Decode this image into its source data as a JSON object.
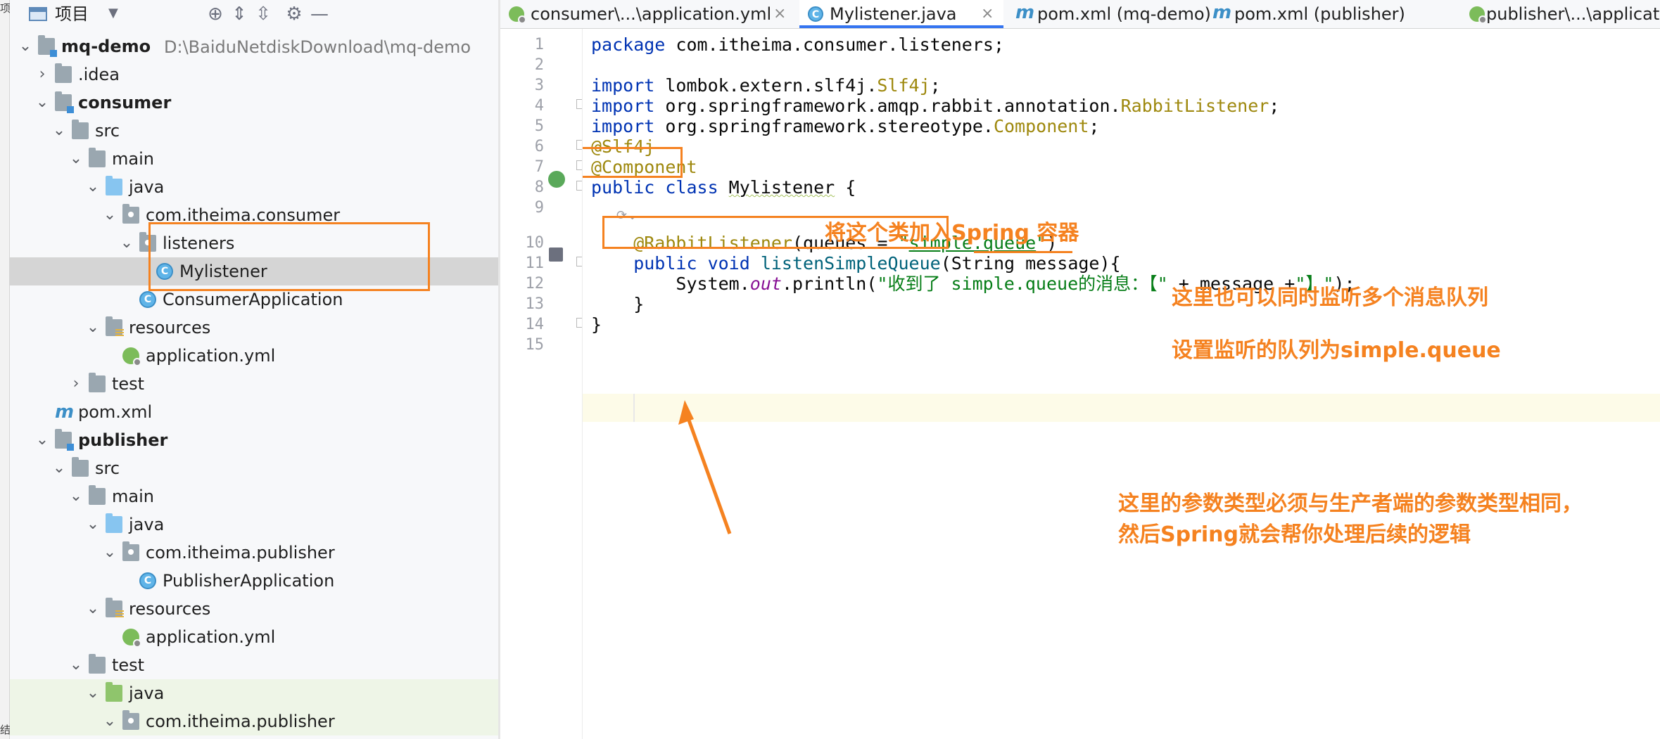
{
  "left_strip": {
    "chars_top": "项",
    "chars_bottom": "结"
  },
  "project_panel": {
    "title": "项目",
    "icons": [
      "locate-icon",
      "expand-all-icon",
      "collapse-all-icon",
      "settings-icon",
      "hide-icon"
    ]
  },
  "tree": [
    {
      "label": "mq-demo",
      "path": "D:\\BaiduNetdiskDownload\\mq-demo",
      "bold": true
    },
    {
      "label": ".idea"
    },
    {
      "label": "consumer",
      "bold": true
    },
    {
      "label": "src"
    },
    {
      "label": "main"
    },
    {
      "label": "java"
    },
    {
      "label": "com.itheima.consumer"
    },
    {
      "label": "listeners"
    },
    {
      "label": "Mylistener"
    },
    {
      "label": "ConsumerApplication"
    },
    {
      "label": "resources"
    },
    {
      "label": "application.yml"
    },
    {
      "label": "test"
    },
    {
      "label": "pom.xml"
    },
    {
      "label": "publisher",
      "bold": true
    },
    {
      "label": "src"
    },
    {
      "label": "main"
    },
    {
      "label": "java"
    },
    {
      "label": "com.itheima.publisher"
    },
    {
      "label": "PublisherApplication"
    },
    {
      "label": "resources"
    },
    {
      "label": "application.yml"
    },
    {
      "label": "test"
    },
    {
      "label": "java"
    },
    {
      "label": "com.itheima.publisher"
    }
  ],
  "tabs": [
    {
      "label": "consumer\\...\\application.yml",
      "icon": "spring-yml-icon",
      "closable": true
    },
    {
      "label": "Mylistener.java",
      "icon": "class-icon",
      "closable": true,
      "active": true
    },
    {
      "label": "pom.xml (mq-demo)",
      "icon": "maven-icon"
    },
    {
      "label": "pom.xml (publisher)",
      "icon": "maven-icon"
    },
    {
      "label": "publisher\\...\\applicat",
      "icon": "spring-yml-icon"
    }
  ],
  "editor": {
    "line_numbers": [
      "1",
      "2",
      "3",
      "4",
      "5",
      "6",
      "7",
      "8",
      "9",
      "10",
      "11",
      "12",
      "13",
      "14",
      "15"
    ],
    "code": {
      "l1_kw": "package",
      "l1_rest": " com.itheima.consumer.listeners;",
      "l3_kw": "import",
      "l3_pre": " lombok.extern.slf4j.",
      "l3_cls": "Slf4j",
      "l3_end": ";",
      "l4_kw": "import",
      "l4_pre": " org.springframework.amqp.rabbit.annotation.",
      "l4_cls": "RabbitListener",
      "l4_end": ";",
      "l5_kw": "import",
      "l5_pre": " org.springframework.stereotype.",
      "l5_cls": "Component",
      "l5_end": ";",
      "l6": "@Slf4j",
      "l7": "@Component",
      "l8_kw1": "public",
      "l8_kw2": " class ",
      "l8_name": "Mylistener",
      "l8_end": " {",
      "l10_ann": "    @RabbitListener",
      "l10_a": "(queues = ",
      "l10_q1": "\"",
      "l10_link": "simple.queue",
      "l10_q2": "\"",
      "l10_b": ")",
      "l11_kw1": "    public",
      "l11_kw2": " void ",
      "l11_meth": "listenSimpleQueue",
      "l11_rest": "(String message){",
      "l12_a": "        System.",
      "l12_out": "out",
      "l12_b": ".println(",
      "l12_s1": "\"收到了 simple.queue的消息：【\"",
      "l12_c": " + message +",
      "l12_s2": "\"】\"",
      "l12_d": ");",
      "l13": "    }",
      "l14": "}"
    }
  },
  "annotations": {
    "component_note": "将这个类加入Spring 容器",
    "multi_queue_note": "这里也可以同时监听多个消息队列",
    "queue_note": "设置监听的队列为simple.queue",
    "param_note_1": "这里的参数类型必须与生产者端的参数类型相同，",
    "param_note_2": "然后Spring就会帮你处理后续的逻辑",
    "color": "#f58220"
  }
}
